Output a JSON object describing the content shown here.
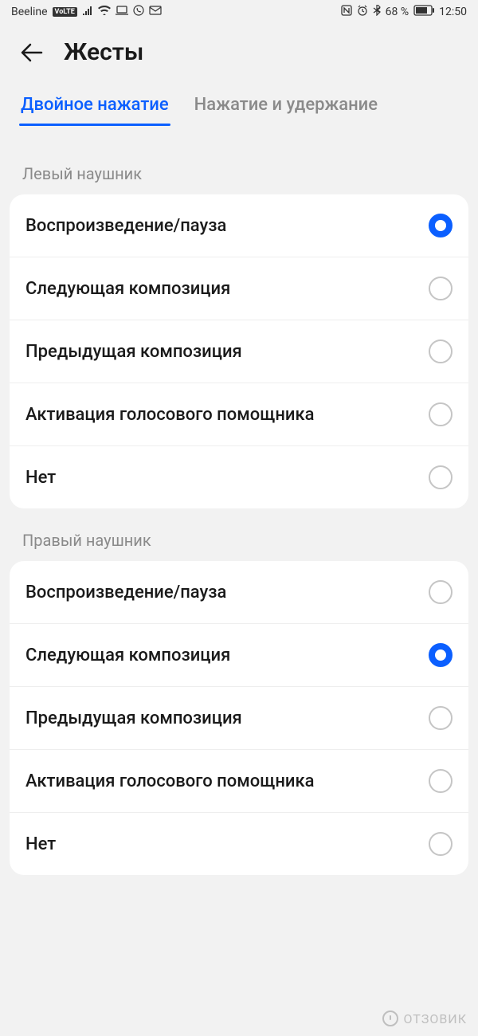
{
  "status": {
    "carrier": "Beeline",
    "volte": "VoLTE",
    "battery_text": "68 %",
    "time": "12:50"
  },
  "header": {
    "title": "Жесты"
  },
  "tabs": [
    {
      "label": "Двойное нажатие",
      "active": true
    },
    {
      "label": "Нажатие и удержание",
      "active": false
    }
  ],
  "sections": [
    {
      "title": "Левый наушник",
      "options": [
        {
          "label": "Воспроизведение/пауза",
          "selected": true
        },
        {
          "label": "Следующая композиция",
          "selected": false
        },
        {
          "label": "Предыдущая композиция",
          "selected": false
        },
        {
          "label": "Активация голосового помощника",
          "selected": false
        },
        {
          "label": "Нет",
          "selected": false
        }
      ]
    },
    {
      "title": "Правый наушник",
      "options": [
        {
          "label": "Воспроизведение/пауза",
          "selected": false
        },
        {
          "label": "Следующая композиция",
          "selected": true
        },
        {
          "label": "Предыдущая композиция",
          "selected": false
        },
        {
          "label": "Активация голосового помощника",
          "selected": false
        },
        {
          "label": "Нет",
          "selected": false
        }
      ]
    }
  ],
  "watermark": "ОТЗОВИК"
}
